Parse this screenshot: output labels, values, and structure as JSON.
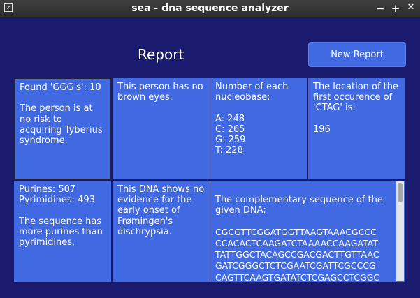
{
  "window": {
    "title": "sea - dna sequence analyzer",
    "minimize": "−",
    "maximize": "+",
    "close": "✕"
  },
  "heading": "Report",
  "new_report_label": "New Report",
  "cells": {
    "ggg": "Found 'GGG's': 10\n\nThe person is at no risk to acquiring Tyberius syndrome.",
    "eyes": "This person has no brown eyes.",
    "nucleobase": "Number of each nucleobase:\n\nA: 248\nC: 265\nG: 259\nT: 228",
    "ctag": "The location of the first occurence of 'CTAG' is:\n\n196",
    "purines": "Purines: 507\nPyrimidines: 493\n\nThe sequence has more purines than pyrimidines.",
    "dischrypsia": "This DNA shows no evidence for the early onset of Frømingen's dischrypsia.",
    "complementary_label": "The complementary sequence of the given DNA:",
    "complementary_sequence": "CGCGTTCGGATGGTTAAGTAAACGCCC\nCCACACTCAAGATCTAAAACCAAGATAT\nTATTGGCTACAGCCGACGACTTGTTAAC\nGATCGGGCTCTCGAATCGATTCGCCCG\nCAGTTCAAGTGATATCTCGAGCCTCGGC\nATTGTCACGCGGATTGTACATTCGGCAG"
  },
  "colors": {
    "background": "#1a1a6e",
    "cell": "#4169e1",
    "titlebar": "#333333"
  }
}
